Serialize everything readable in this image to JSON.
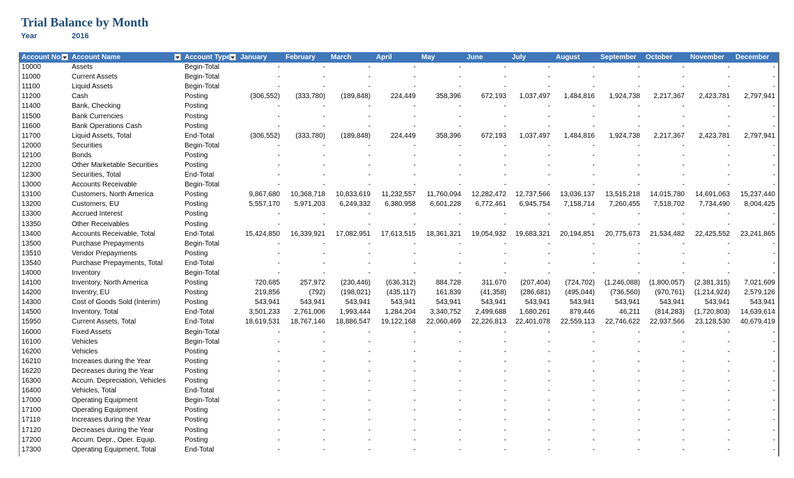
{
  "report": {
    "title": "Trial Balance by Month",
    "year_label": "Year",
    "year_value": "2016"
  },
  "columns": [
    "Account No.",
    "Account Name",
    "Account Type",
    "January",
    "February",
    "March",
    "April",
    "May",
    "June",
    "July",
    "August",
    "September",
    "October",
    "November",
    "December"
  ],
  "rows": [
    [
      "10000",
      "Assets",
      "Begin-Total",
      "-",
      "-",
      "-",
      "-",
      "-",
      "-",
      "-",
      "-",
      "-",
      "-",
      "-",
      "-"
    ],
    [
      "11000",
      "Current Assets",
      "Begin-Total",
      "-",
      "-",
      "-",
      "-",
      "-",
      "-",
      "-",
      "-",
      "-",
      "-",
      "-",
      "-"
    ],
    [
      "11100",
      "Liquid Assets",
      "Begin-Total",
      "-",
      "-",
      "-",
      "-",
      "-",
      "-",
      "-",
      "-",
      "-",
      "-",
      "-",
      "-"
    ],
    [
      "11200",
      "Cash",
      "Posting",
      "(306,552)",
      "(333,780)",
      "(189,848)",
      "224,449",
      "358,396",
      "672,193",
      "1,037,497",
      "1,484,816",
      "1,924,738",
      "2,217,367",
      "2,423,781",
      "2,797,941"
    ],
    [
      "11400",
      "Bank, Checking",
      "Posting",
      "-",
      "-",
      "-",
      "-",
      "-",
      "-",
      "-",
      "-",
      "-",
      "-",
      "-",
      "-"
    ],
    [
      "11500",
      "Bank Currencies",
      "Posting",
      "-",
      "-",
      "-",
      "-",
      "-",
      "-",
      "-",
      "-",
      "-",
      "-",
      "-",
      "-"
    ],
    [
      "11600",
      "Bank Operations Cash",
      "Posting",
      "-",
      "-",
      "-",
      "-",
      "-",
      "-",
      "-",
      "-",
      "-",
      "-",
      "-",
      "-"
    ],
    [
      "11700",
      "Liquid Assets, Total",
      "End-Total",
      "(306,552)",
      "(333,780)",
      "(189,848)",
      "224,449",
      "358,396",
      "672,193",
      "1,037,497",
      "1,484,816",
      "1,924,738",
      "2,217,367",
      "2,423,781",
      "2,797,941"
    ],
    [
      "12000",
      "Securities",
      "Begin-Total",
      "-",
      "-",
      "-",
      "-",
      "-",
      "-",
      "-",
      "-",
      "-",
      "-",
      "-",
      "-"
    ],
    [
      "12100",
      "Bonds",
      "Posting",
      "-",
      "-",
      "-",
      "-",
      "-",
      "-",
      "-",
      "-",
      "-",
      "-",
      "-",
      "-"
    ],
    [
      "12200",
      "Other Marketable Securities",
      "Posting",
      "-",
      "-",
      "-",
      "-",
      "-",
      "-",
      "-",
      "-",
      "-",
      "-",
      "-",
      "-"
    ],
    [
      "12300",
      "Securities, Total",
      "End-Total",
      "-",
      "-",
      "-",
      "-",
      "-",
      "-",
      "-",
      "-",
      "-",
      "-",
      "-",
      "-"
    ],
    [
      "13000",
      "Accounts Receivable",
      "Begin-Total",
      "-",
      "-",
      "-",
      "-",
      "-",
      "-",
      "-",
      "-",
      "-",
      "-",
      "-",
      "-"
    ],
    [
      "13100",
      "Customers, North America",
      "Posting",
      "9,867,680",
      "10,368,718",
      "10,833,619",
      "11,232,557",
      "11,760,094",
      "12,282,472",
      "12,737,566",
      "13,036,137",
      "13,515,218",
      "14,015,780",
      "14,691,063",
      "15,237,440"
    ],
    [
      "13200",
      "Customers, EU",
      "Posting",
      "5,557,170",
      "5,971,203",
      "6,249,332",
      "6,380,958",
      "6,601,228",
      "6,772,461",
      "6,945,754",
      "7,158,714",
      "7,260,455",
      "7,518,702",
      "7,734,490",
      "8,004,425"
    ],
    [
      "13300",
      "Accrued Interest",
      "Posting",
      "-",
      "-",
      "-",
      "-",
      "-",
      "-",
      "-",
      "-",
      "-",
      "-",
      "-",
      "-"
    ],
    [
      "13350",
      "Other Receivables",
      "Posting",
      "-",
      "-",
      "-",
      "-",
      "-",
      "-",
      "-",
      "-",
      "-",
      "-",
      "-",
      "-"
    ],
    [
      "13400",
      "Accounts Receivable, Total",
      "End-Total",
      "15,424,850",
      "16,339,921",
      "17,082,951",
      "17,613,515",
      "18,361,321",
      "19,054,932",
      "19,683,321",
      "20,194,851",
      "20,775,673",
      "21,534,482",
      "22,425,552",
      "23,241,865"
    ],
    [
      "13500",
      "Purchase Prepayments",
      "Begin-Total",
      "-",
      "-",
      "-",
      "-",
      "-",
      "-",
      "-",
      "-",
      "-",
      "-",
      "-",
      "-"
    ],
    [
      "13510",
      "Vendor Prepayments",
      "Posting",
      "-",
      "-",
      "-",
      "-",
      "-",
      "-",
      "-",
      "-",
      "-",
      "-",
      "-",
      "-"
    ],
    [
      "13540",
      "Purchase Prepayments, Total",
      "End-Total",
      "-",
      "-",
      "-",
      "-",
      "-",
      "-",
      "-",
      "-",
      "-",
      "-",
      "-",
      "-"
    ],
    [
      "14000",
      "Inventory",
      "Begin-Total",
      "-",
      "-",
      "-",
      "-",
      "-",
      "-",
      "-",
      "-",
      "-",
      "-",
      "-",
      "-"
    ],
    [
      "14100",
      "Inventory, North America",
      "Posting",
      "720,685",
      "257,972",
      "(230,446)",
      "(636,312)",
      "884,728",
      "311,670",
      "(207,404)",
      "(724,702)",
      "(1,246,088)",
      "(1,800,057)",
      "(2,381,315)",
      "7,021,609"
    ],
    [
      "14200",
      "Inventry, EU",
      "Posting",
      "219,856",
      "(792)",
      "(198,021)",
      "(435,117)",
      "161,839",
      "(41,358)",
      "(286,681)",
      "(495,044)",
      "(736,560)",
      "(970,761)",
      "(1,214,924)",
      "2,579,126"
    ],
    [
      "14300",
      "Cost of Goods Sold (Interim)",
      "Posting",
      "543,941",
      "543,941",
      "543,941",
      "543,941",
      "543,941",
      "543,941",
      "543,941",
      "543,941",
      "543,941",
      "543,941",
      "543,941",
      "543,941"
    ],
    [
      "14500",
      "Inventory, Total",
      "End-Total",
      "3,501,233",
      "2,761,006",
      "1,993,444",
      "1,284,204",
      "3,340,752",
      "2,499,688",
      "1,680,261",
      "879,446",
      "46,211",
      "(814,283)",
      "(1,720,803)",
      "14,639,614"
    ],
    [
      "15950",
      "Current Assets, Total",
      "End-Total",
      "18,619,531",
      "18,767,146",
      "18,886,547",
      "19,122,168",
      "22,060,469",
      "22,226,813",
      "22,401,078",
      "22,559,113",
      "22,746,622",
      "22,937,566",
      "23,128,530",
      "40,679,419"
    ],
    [
      "16000",
      "Fixed Assets",
      "Begin-Total",
      "-",
      "-",
      "-",
      "-",
      "-",
      "-",
      "-",
      "-",
      "-",
      "-",
      "-",
      "-"
    ],
    [
      "16100",
      "Vehicles",
      "Begin-Total",
      "-",
      "-",
      "-",
      "-",
      "-",
      "-",
      "-",
      "-",
      "-",
      "-",
      "-",
      "-"
    ],
    [
      "16200",
      "Vehicles",
      "Posting",
      "-",
      "-",
      "-",
      "-",
      "-",
      "-",
      "-",
      "-",
      "-",
      "-",
      "-",
      "-"
    ],
    [
      "16210",
      "Increases during the Year",
      "Posting",
      "-",
      "-",
      "-",
      "-",
      "-",
      "-",
      "-",
      "-",
      "-",
      "-",
      "-",
      "-"
    ],
    [
      "16220",
      "Decreases during the Year",
      "Posting",
      "-",
      "-",
      "-",
      "-",
      "-",
      "-",
      "-",
      "-",
      "-",
      "-",
      "-",
      "-"
    ],
    [
      "16300",
      "Accum. Depreciation, Vehicles",
      "Posting",
      "-",
      "-",
      "-",
      "-",
      "-",
      "-",
      "-",
      "-",
      "-",
      "-",
      "-",
      "-"
    ],
    [
      "16400",
      "Vehicles, Total",
      "End-Total",
      "-",
      "-",
      "-",
      "-",
      "-",
      "-",
      "-",
      "-",
      "-",
      "-",
      "-",
      "-"
    ],
    [
      "17000",
      "Operating Equipment",
      "Begin-Total",
      "-",
      "-",
      "-",
      "-",
      "-",
      "-",
      "-",
      "-",
      "-",
      "-",
      "-",
      "-"
    ],
    [
      "17100",
      "Operating Equipment",
      "Posting",
      "-",
      "-",
      "-",
      "-",
      "-",
      "-",
      "-",
      "-",
      "-",
      "-",
      "-",
      "-"
    ],
    [
      "17110",
      "Increases during the Year",
      "Posting",
      "-",
      "-",
      "-",
      "-",
      "-",
      "-",
      "-",
      "-",
      "-",
      "-",
      "-",
      "-"
    ],
    [
      "17120",
      "Decreases during the Year",
      "Posting",
      "-",
      "-",
      "-",
      "-",
      "-",
      "-",
      "-",
      "-",
      "-",
      "-",
      "-",
      "-"
    ],
    [
      "17200",
      "Accum. Depr., Oper. Equip.",
      "Posting",
      "-",
      "-",
      "-",
      "-",
      "-",
      "-",
      "-",
      "-",
      "-",
      "-",
      "-",
      "-"
    ],
    [
      "17300",
      "Operating Equipment, Total",
      "End-Total",
      "-",
      "-",
      "-",
      "-",
      "-",
      "-",
      "-",
      "-",
      "-",
      "-",
      "-",
      "-"
    ]
  ]
}
